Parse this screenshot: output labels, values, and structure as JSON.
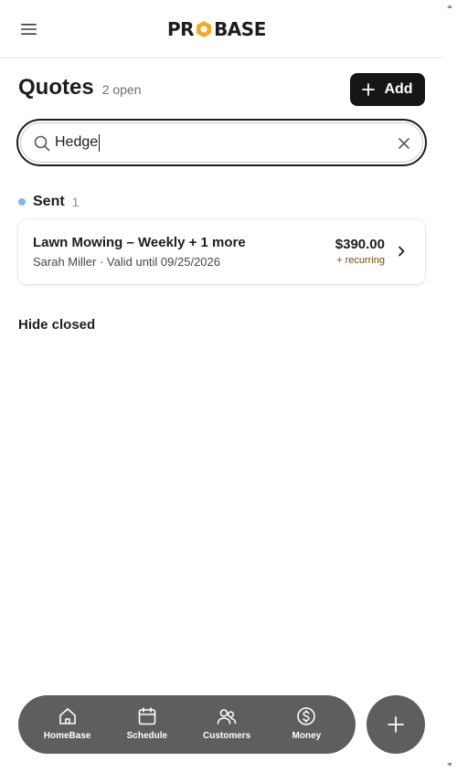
{
  "header": {
    "logo_text_left": "PR",
    "logo_text_right": "BASE",
    "brand_accent": "#f0a92b"
  },
  "page": {
    "title": "Quotes",
    "open_count": "2 open",
    "add_label": "Add"
  },
  "search": {
    "value": "Hedge"
  },
  "section": {
    "label": "Sent",
    "count": "1",
    "dot_color": "#7fb6f2"
  },
  "quotes": [
    {
      "title": "Lawn Mowing – Weekly + 1 more",
      "subtitle": "Sarah Miller · Valid until 09/25/2026",
      "amount": "$390.00",
      "recurring": "+ recurring"
    }
  ],
  "hide_closed_label": "Hide closed",
  "nav": {
    "items": [
      {
        "label": "HomeBase",
        "icon": "home-icon"
      },
      {
        "label": "Schedule",
        "icon": "calendar-icon"
      },
      {
        "label": "Customers",
        "icon": "customers-icon"
      },
      {
        "label": "Money",
        "icon": "money-icon"
      }
    ],
    "fab_icon": "plus-icon"
  }
}
